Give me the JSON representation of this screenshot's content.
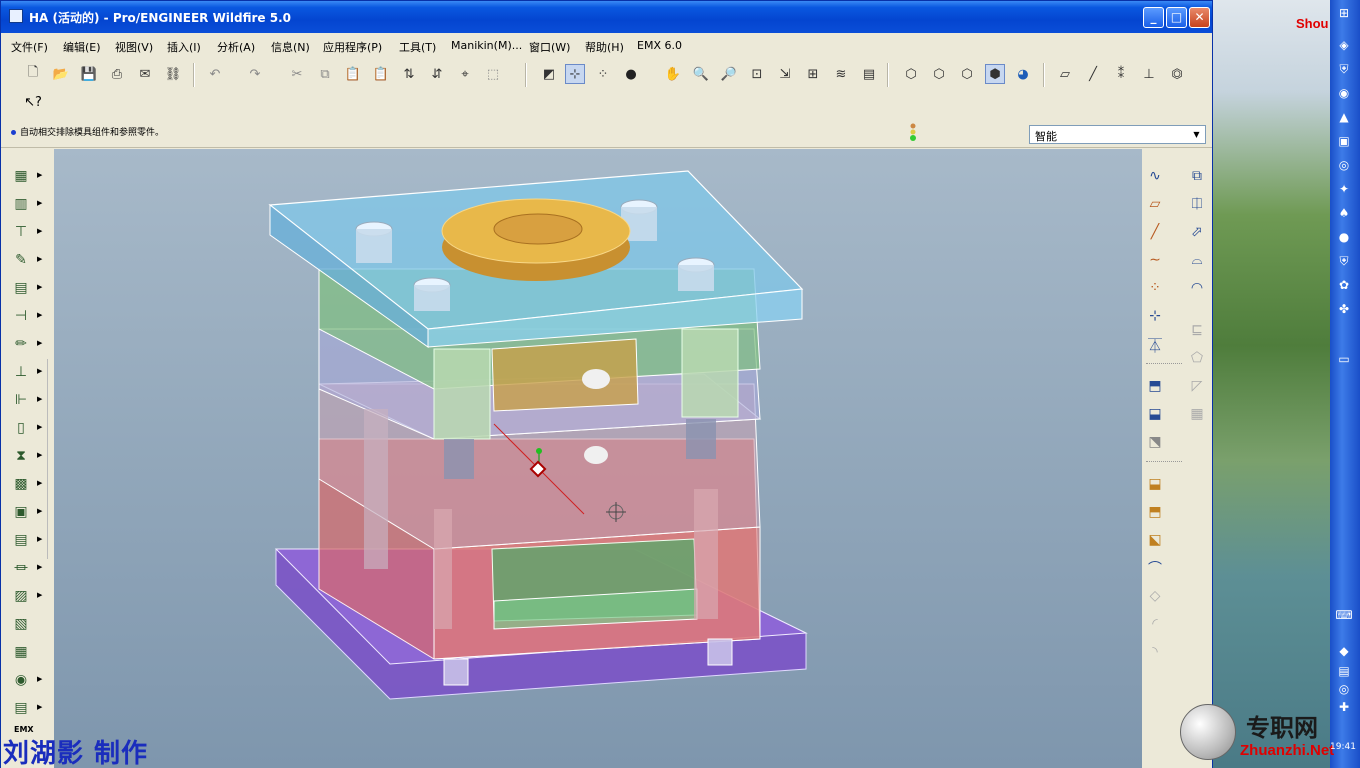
{
  "window": {
    "title": "HA (活动的) - Pro/ENGINEER Wildfire 5.0",
    "min_label": "_",
    "max_label": "□",
    "close_label": "✕"
  },
  "menu": [
    "文件(F)",
    "编辑(E)",
    "视图(V)",
    "插入(I)",
    "分析(A)",
    "信息(N)",
    "应用程序(P)",
    "工具(T)",
    "Manikin(M)...",
    "窗口(W)",
    "帮助(H)",
    "EMX 6.0"
  ],
  "toolbar": {
    "icons": [
      "new-icon",
      "open-icon",
      "save-icon",
      "print-icon",
      "send-mail-icon",
      "send-link-icon",
      "undo-icon",
      "redo-icon",
      "cut-icon",
      "copy-icon",
      "paste-icon",
      "paste-special-icon",
      "regenerate-icon",
      "regen-manager-icon",
      "find-icon",
      "select-box-icon",
      "datum-display-icon",
      "axis-display-icon",
      "point-display-icon",
      "sphere-icon",
      "spin-center-icon",
      "pan-icon",
      "zoom-in-icon",
      "zoom-out-icon",
      "refit-icon",
      "reorient-icon",
      "saved-views-icon",
      "layers-icon",
      "view-manager-icon",
      "wireframe-icon",
      "hidden-line-icon",
      "no-hidden-icon",
      "shading-icon",
      "enhanced-realism-icon",
      "plane-tool-icon",
      "axis-tool-icon",
      "point-tool-icon",
      "csys-tool-icon",
      "datum-filter-icon",
      "whats-this-icon"
    ]
  },
  "message": {
    "text": "自动相交排除模具组件和参照零件。"
  },
  "filter": {
    "value": "智能"
  },
  "desktop": {
    "label": "Shou"
  },
  "watermark": {
    "cn": "专职网",
    "en": "Zhuanzhi.Net",
    "time": "19:41"
  },
  "author": "刘湖影 制作",
  "emx_label": "EMX",
  "colors": {
    "titlebar": "#0a58e0",
    "viewport": "#94a9bc",
    "plate_top": "#7fc7e8",
    "plate_bottom": "#7a4fc8",
    "cavity": "#7fbf7f",
    "core": "#d86a6a",
    "ring": "#e8b84a"
  }
}
